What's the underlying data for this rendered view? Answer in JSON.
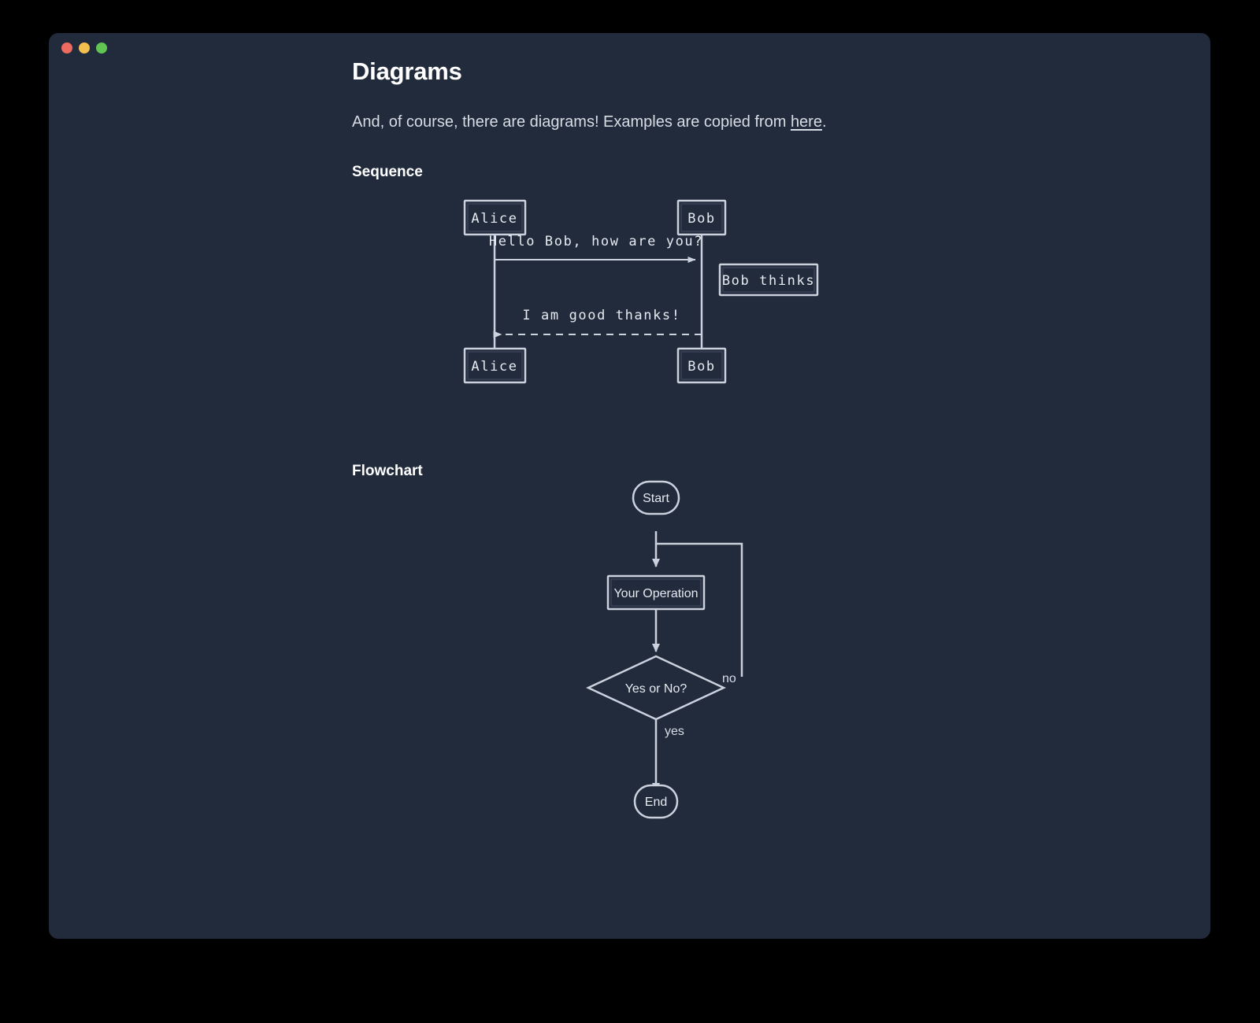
{
  "window": {
    "traffic_lights": [
      {
        "name": "close",
        "color": "#ec6a5f"
      },
      {
        "name": "minimize",
        "color": "#f3bf4f"
      },
      {
        "name": "maximize",
        "color": "#61c554"
      }
    ],
    "background": "#222b3c",
    "outer_background": "#000000"
  },
  "page": {
    "title": "Diagrams",
    "intro_before_link": "And, of course, there are diagrams! Examples are copied from ",
    "intro_link": "here",
    "intro_after_link": "."
  },
  "sections": [
    {
      "id": "sequence",
      "heading": "Sequence"
    },
    {
      "id": "flowchart",
      "heading": "Flowchart"
    }
  ],
  "sequence_diagram": {
    "participants": [
      {
        "id": "alice",
        "label": "Alice"
      },
      {
        "id": "bob",
        "label": "Bob"
      }
    ],
    "messages": [
      {
        "from": "alice",
        "to": "bob",
        "text": "Hello Bob, how are you?",
        "style": "solid"
      },
      {
        "from": "bob",
        "to": "alice",
        "text": "I am good thanks!",
        "style": "dashed"
      }
    ],
    "notes": [
      {
        "anchor": "bob",
        "position": "right of",
        "text": "Bob thinks"
      }
    ]
  },
  "flowchart": {
    "nodes": [
      {
        "id": "start",
        "label": "Start",
        "shape": "stadium"
      },
      {
        "id": "op",
        "label": "Your Operation",
        "shape": "rect"
      },
      {
        "id": "decide",
        "label": "Yes or No?",
        "shape": "diamond"
      },
      {
        "id": "end",
        "label": "End",
        "shape": "stadium"
      }
    ],
    "edges": [
      {
        "from": "start",
        "to": "op",
        "label": ""
      },
      {
        "from": "op",
        "to": "decide",
        "label": ""
      },
      {
        "from": "decide",
        "to": "end",
        "label": "yes"
      },
      {
        "from": "decide",
        "to": "op",
        "label": "no"
      }
    ]
  },
  "colors": {
    "stroke": "#ccd2dd",
    "node_fill": "#222b3c",
    "text": "#e6eaf1",
    "heading": "#ffffff",
    "body_text": "#d7dce5"
  }
}
